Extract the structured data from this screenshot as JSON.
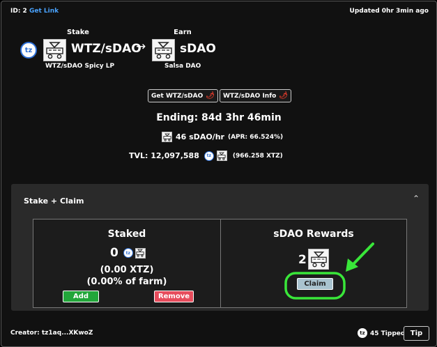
{
  "header": {
    "id_label": "ID: 2",
    "get_link": "Get Link",
    "updated": "Updated 0hr 3min ago"
  },
  "stake": {
    "label": "Stake",
    "pair": "WTZ/sDAO",
    "pool_name": "WTZ/sDAO Spicy LP",
    "tz_icon_text": "tz"
  },
  "earn": {
    "label": "Earn",
    "token": "sDAO",
    "name": "Salsa DAO"
  },
  "arrow": "→",
  "actions": {
    "get_button": "Get WTZ/sDAO",
    "info_button": "WTZ/sDAO Info",
    "chili_icon": "🌶"
  },
  "farm": {
    "ending": "Ending: 84d 3hr 46min",
    "rate": "46 sDAO/hr",
    "apr": "(APR: 66.524%)",
    "tvl": "TVL: 12,097,588",
    "tvl_xtz": "(966.258 XTZ)"
  },
  "panel": {
    "title": "Stake + Claim",
    "collapse_icon": "⌃",
    "staked": {
      "title": "Staked",
      "amount": "0",
      "xtz": "(0.00 XTZ)",
      "percent": "(0.00% of farm)",
      "add_button": "Add",
      "remove_button": "Remove"
    },
    "rewards": {
      "title": "sDAO Rewards",
      "amount": "2",
      "claim_button": "Claim"
    }
  },
  "annotation_color": "#39e639",
  "footer": {
    "creator": "Creator: tz1aq...XKwoZ",
    "tipped": "45 Tipped",
    "tip_button": "Tip"
  }
}
